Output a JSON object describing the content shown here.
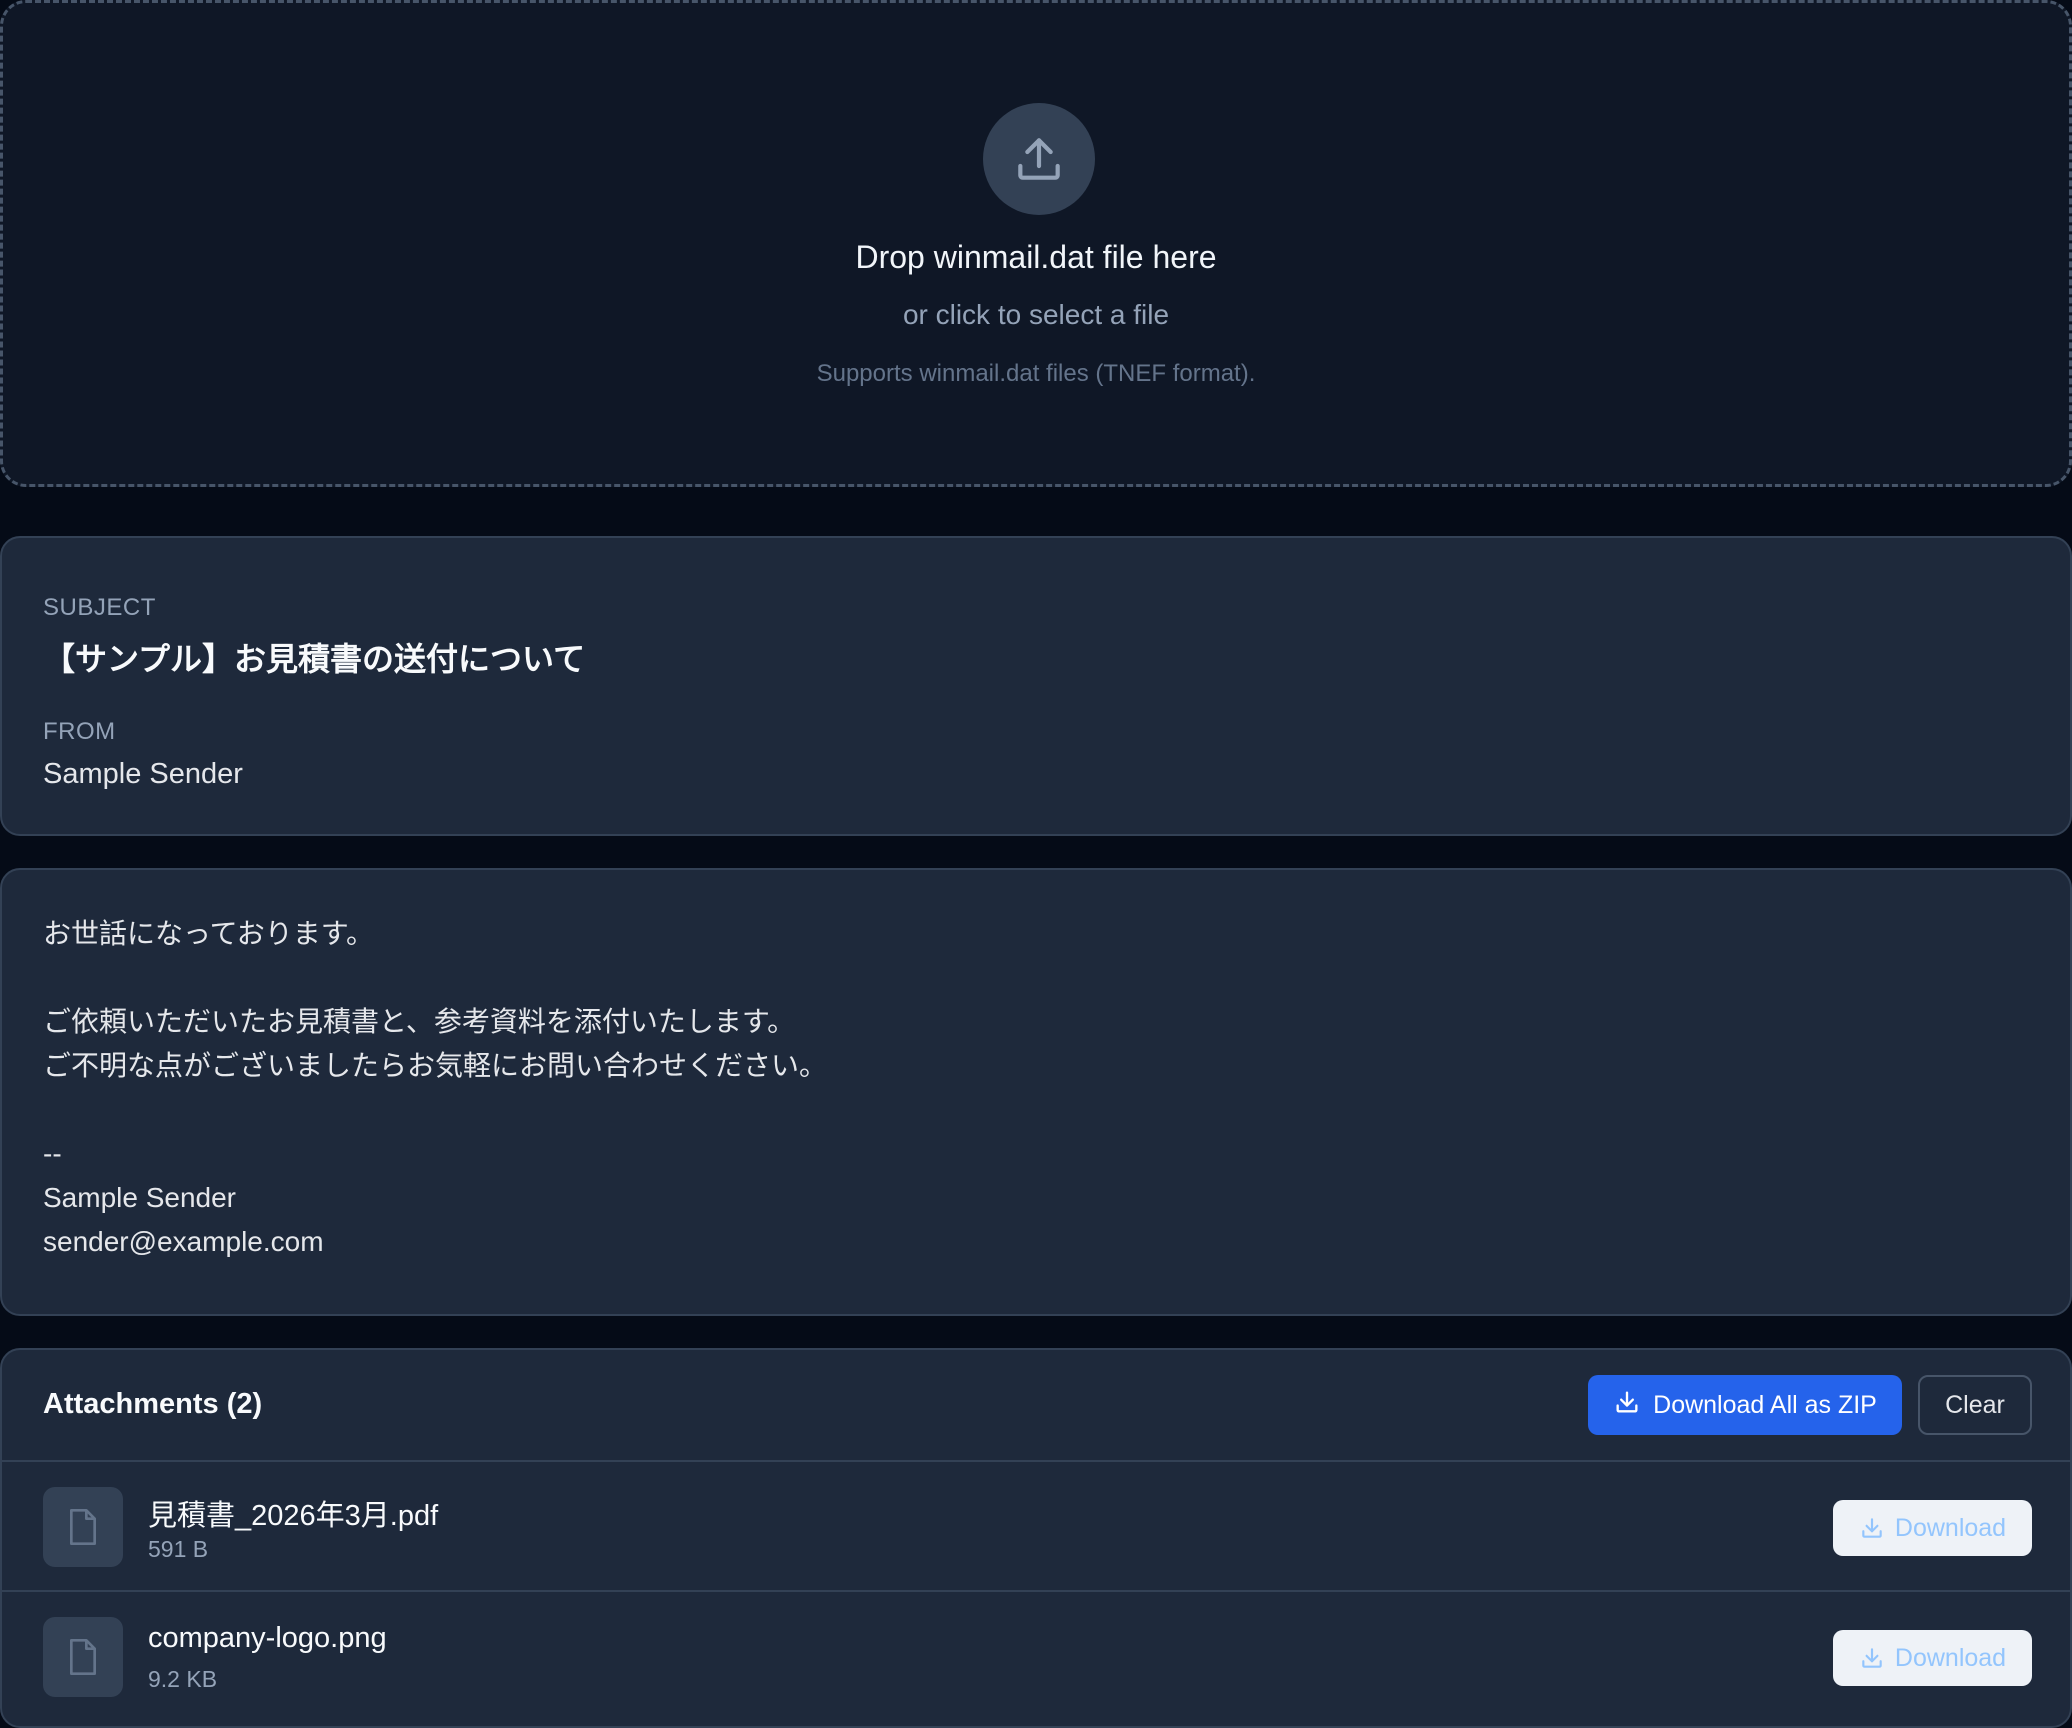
{
  "dropzone": {
    "title": "Drop winmail.dat file here",
    "subtitle": "or click to select a file",
    "note": "Supports winmail.dat files (TNEF format).",
    "icon": "upload-icon"
  },
  "message": {
    "subject_label": "SUBJECT",
    "subject": "【サンプル】お見積書の送付について",
    "from_label": "FROM",
    "from": "Sample Sender"
  },
  "body": {
    "lines": [
      "お世話になっております。",
      "",
      "ご依頼いただいたお見積書と、参考資料を添付いたします。",
      "ご不明な点がございましたらお気軽にお問い合わせください。",
      "",
      "--",
      "Sample Sender",
      "sender@example.com"
    ]
  },
  "attachments": {
    "title": "Attachments (2)",
    "download_all_label": "Download All as ZIP",
    "clear_label": "Clear",
    "items": [
      {
        "name": "見積書_2026年3月.pdf",
        "size": "591 B",
        "download_label": "Download",
        "icon": "file-icon"
      },
      {
        "name": "company-logo.png",
        "size": "9.2 KB",
        "download_label": "Download",
        "icon": "file-icon"
      }
    ]
  },
  "colors": {
    "page_bg": "#050b17",
    "card_bg": "#1e293b",
    "dropzone_bg": "#0f1726",
    "accent": "#2563eb",
    "download_text": "#93c5fd"
  }
}
